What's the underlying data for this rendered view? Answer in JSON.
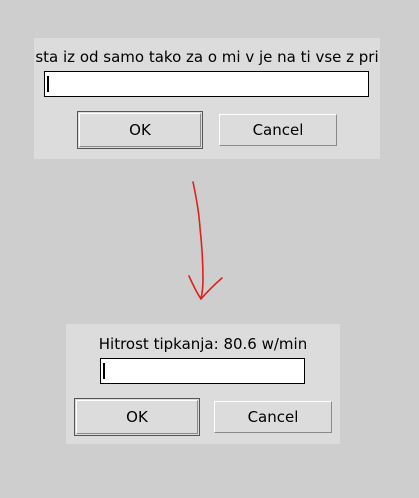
{
  "dialogs": [
    {
      "prompt": "sta iz od samo tako za o mi v je na ti vse z pri",
      "input_value": "",
      "ok_label": "OK",
      "cancel_label": "Cancel"
    },
    {
      "prompt": "Hitrost tipkanja: 80.6 w/min",
      "input_value": "",
      "ok_label": "OK",
      "cancel_label": "Cancel"
    }
  ],
  "annotation": {
    "arrow_color": "#e02020"
  },
  "colors": {
    "background": "#cecece",
    "dialog": "#dcdcdc",
    "field": "#ffffff"
  }
}
